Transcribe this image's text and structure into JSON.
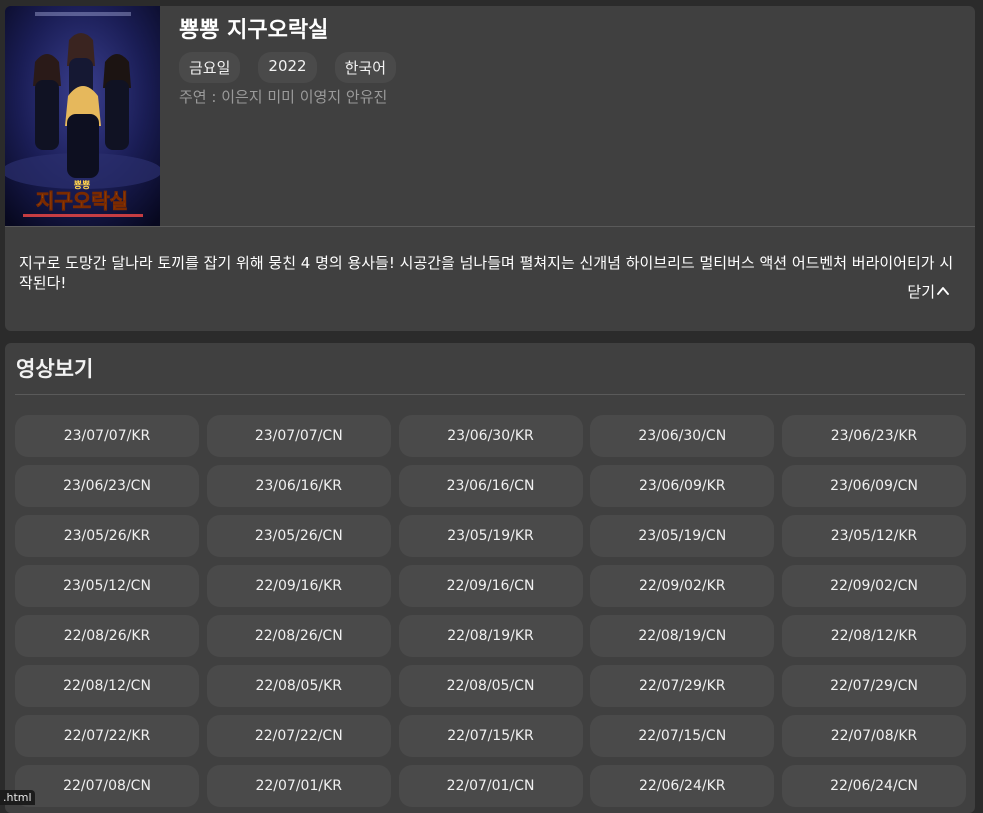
{
  "show": {
    "title": "뿅뿅 지구오락실",
    "tags": [
      "금요일",
      "2022",
      "한국어"
    ],
    "cast": "주연 : 이은지 미미 이영지 안유진",
    "description": "지구로 도망간 달나라 토끼를 잡기 위해 뭉친 4 명의 용사들! 시공간을 넘나들며 펼쳐지는 신개념 하이브리드 멀티버스 액션 어드벤처 버라이어티가 시작된다!",
    "close_label": "닫기",
    "close_icon": "chevron-up-icon"
  },
  "videos": {
    "section_title": "영상보기",
    "episodes": [
      "23/07/07/KR",
      "23/07/07/CN",
      "23/06/30/KR",
      "23/06/30/CN",
      "23/06/23/KR",
      "23/06/23/CN",
      "23/06/16/KR",
      "23/06/16/CN",
      "23/06/09/KR",
      "23/06/09/CN",
      "23/05/26/KR",
      "23/05/26/CN",
      "23/05/19/KR",
      "23/05/19/CN",
      "23/05/12/KR",
      "23/05/12/CN",
      "22/09/16/KR",
      "22/09/16/CN",
      "22/09/02/KR",
      "22/09/02/CN",
      "22/08/26/KR",
      "22/08/26/CN",
      "22/08/19/KR",
      "22/08/19/CN",
      "22/08/12/KR",
      "22/08/12/CN",
      "22/08/05/KR",
      "22/08/05/CN",
      "22/07/29/KR",
      "22/07/29/CN",
      "22/07/22/KR",
      "22/07/22/CN",
      "22/07/15/KR",
      "22/07/15/CN",
      "22/07/08/KR",
      "22/07/08/CN",
      "22/07/01/KR",
      "22/07/01/CN",
      "22/06/24/KR",
      "22/06/24/CN"
    ]
  },
  "status_bar": {
    "text": ".html"
  },
  "colors": {
    "page_background": "#2b2b2b",
    "card_background": "#404040",
    "button_background": "#4a4a4a",
    "muted_text": "#9a9a9a"
  }
}
